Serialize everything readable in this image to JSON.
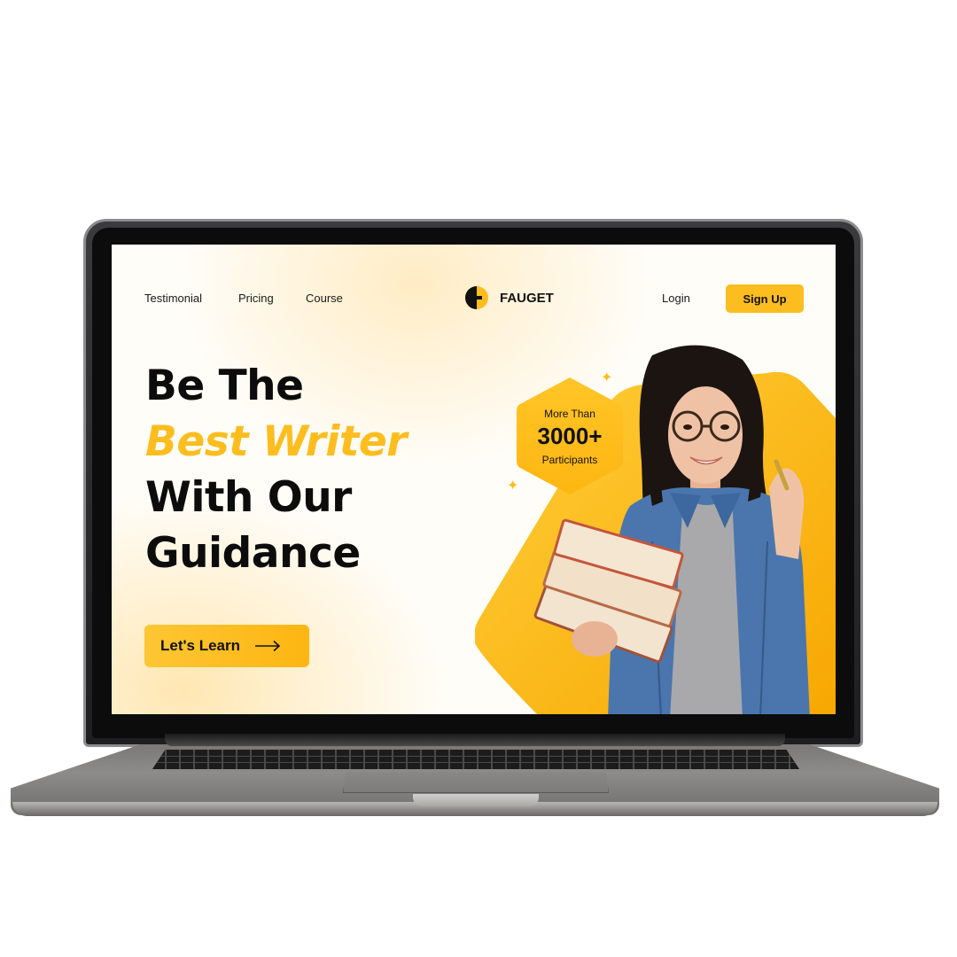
{
  "nav": {
    "links": [
      "Testimonial",
      "Pricing",
      "Course"
    ],
    "login_label": "Login",
    "signup_label": "Sign Up"
  },
  "brand": {
    "name": "FAUGET",
    "logo_icon": "half-circle-logo-icon"
  },
  "hero": {
    "line1": "Be The",
    "line2": "Best Writer",
    "line3": "With Our",
    "line4": "Guidance",
    "cta_label": "Let's Learn",
    "cta_icon": "arrow-right-icon"
  },
  "badge": {
    "top": "More Than",
    "value": "3000+",
    "bottom": "Participants"
  },
  "colors": {
    "accent": "#fdbd1f",
    "accent_dark": "#f7a600",
    "text": "#0c0c0c",
    "denim": "#4a76ad"
  }
}
